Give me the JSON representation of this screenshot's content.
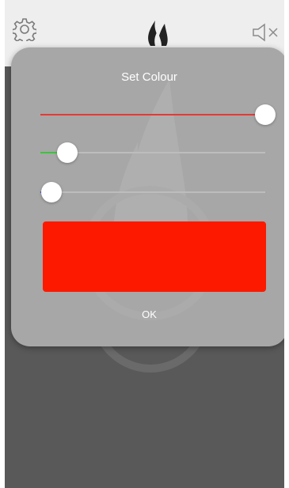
{
  "topbar": {
    "settings_icon": "gear-icon",
    "mute_icon": "speaker-muted-icon",
    "logo": "flame-logo"
  },
  "dialog": {
    "title": "Set Colour",
    "ok_label": "OK",
    "sliders": [
      {
        "name": "red",
        "value": 1.0,
        "fill_color": "#e53935"
      },
      {
        "name": "green",
        "value": 0.12,
        "fill_color": "#3cc43c"
      },
      {
        "name": "blue",
        "value": 0.05,
        "fill_color": "#3b5bdb"
      }
    ],
    "preview_color": "#fc1900"
  },
  "colors": {
    "app_background": "#595959",
    "topbar_background": "#eeeeee",
    "dialog_background": "#a7a7a7"
  }
}
